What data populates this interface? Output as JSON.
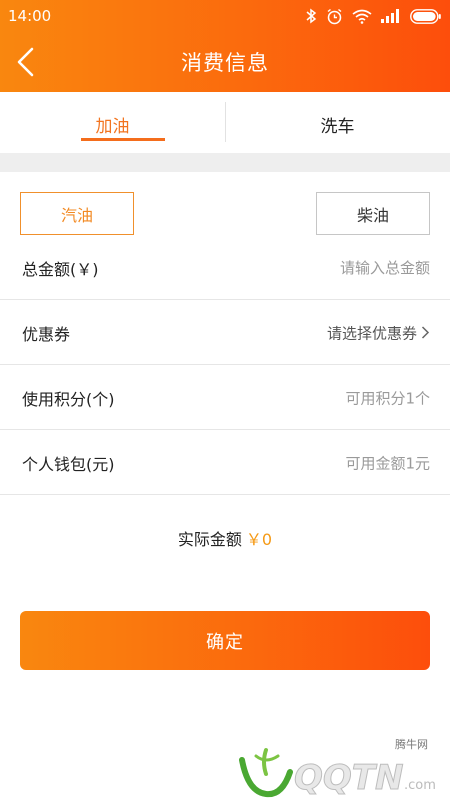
{
  "status_bar": {
    "time": "14:00",
    "icons": [
      "bluetooth-icon",
      "alarm-icon",
      "wifi-icon",
      "signal-icon",
      "battery-icon"
    ]
  },
  "header": {
    "title": "消费信息",
    "back_icon": "chevron-left-icon",
    "gradient_start": "#f9870f",
    "gradient_end": "#fd4e0c"
  },
  "tabs": [
    {
      "label": "加油",
      "active": true
    },
    {
      "label": "洗车",
      "active": false
    }
  ],
  "fuel_types": [
    {
      "label": "汽油",
      "selected": true
    },
    {
      "label": "柴油",
      "selected": false
    }
  ],
  "form": {
    "total_amount": {
      "label": "总金额(￥)",
      "placeholder": "请输入总金额"
    },
    "coupon": {
      "label": "优惠券",
      "value": "请选择优惠券"
    },
    "points": {
      "label": "使用积分(个)",
      "value": "可用积分1个"
    },
    "wallet": {
      "label": "个人钱包(元)",
      "value": "可用金额1元"
    }
  },
  "actual": {
    "label": "实际金额",
    "amount": "￥0"
  },
  "confirm_label": "确定",
  "accent_color": "#f46d1c",
  "watermark": {
    "site": "腾牛网",
    "logo_text": "QQTN.com"
  }
}
